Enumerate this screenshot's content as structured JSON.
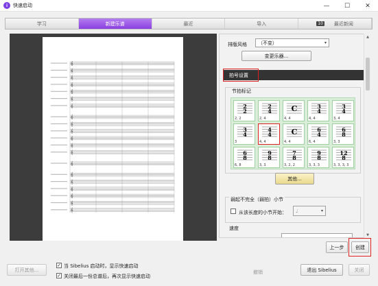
{
  "window": {
    "title": "快速启动",
    "minimize": "—",
    "maximize": "☐",
    "close": "✕"
  },
  "tabs": [
    {
      "label": "学习",
      "active": false
    },
    {
      "label": "新建乐谱",
      "active": true
    },
    {
      "label": "最近",
      "active": false
    },
    {
      "label": "导入",
      "active": false
    },
    {
      "label": "最近新闻",
      "badge": "10",
      "active": false
    }
  ],
  "settings": {
    "layout_label": "排版风格",
    "layout_value": "（不变）",
    "change_instruments": "变更乐器...",
    "section_header": "拍号设置",
    "group_label": "节拍标记",
    "time_signatures": [
      {
        "top": "2",
        "bottom": "2",
        "label": "2, 2"
      },
      {
        "top": "2",
        "bottom": "4",
        "label": "2, 4"
      },
      {
        "top": "C",
        "bottom": "",
        "label": "4, 4"
      },
      {
        "top": "3",
        "bottom": "4",
        "label": "4, 4"
      },
      {
        "top": "3",
        "bottom": "4",
        "label": "3, 4"
      },
      {
        "top": "3",
        "bottom": "4",
        "label": "3"
      },
      {
        "top": "4",
        "bottom": "4",
        "label": "4, 4",
        "selected": true
      },
      {
        "top": "C",
        "bottom": "",
        "label": "4, 4"
      },
      {
        "top": "6",
        "bottom": "4",
        "label": "6, 4"
      },
      {
        "top": "6",
        "bottom": "8",
        "label": "3, 3"
      },
      {
        "top": "6",
        "bottom": "8",
        "label": "6, 8"
      },
      {
        "top": "9",
        "bottom": "8",
        "label": "3, 3"
      },
      {
        "top": "7",
        "bottom": "8",
        "label": "3, 2, 2"
      },
      {
        "top": "9",
        "bottom": "8",
        "label": "3, 3, 3"
      },
      {
        "top": "12",
        "bottom": "8",
        "label": "3, 3, 3, 3"
      }
    ],
    "other_button": "其他...",
    "pickup_group_label": "弱起不完全（弱拍）小节",
    "pickup_checkbox": "从该长度的小节开始：",
    "pickup_value": "♩",
    "tempo_label": "速度"
  },
  "nav": {
    "back": "上一步",
    "create": "创建"
  },
  "footer": {
    "open_other": "打开其他...",
    "show_on_start": "当 Sibelius 启动时，显示快速启动",
    "show_after_close": "关闭最后一份总谱后，再次显示快速启动",
    "cancel": "撤销",
    "exit": "退出 Sibelius",
    "close": "关闭"
  },
  "colors": {
    "accent": "#8a3fe0",
    "highlight": "#e02020",
    "grid_bg": "#d8eed8"
  }
}
